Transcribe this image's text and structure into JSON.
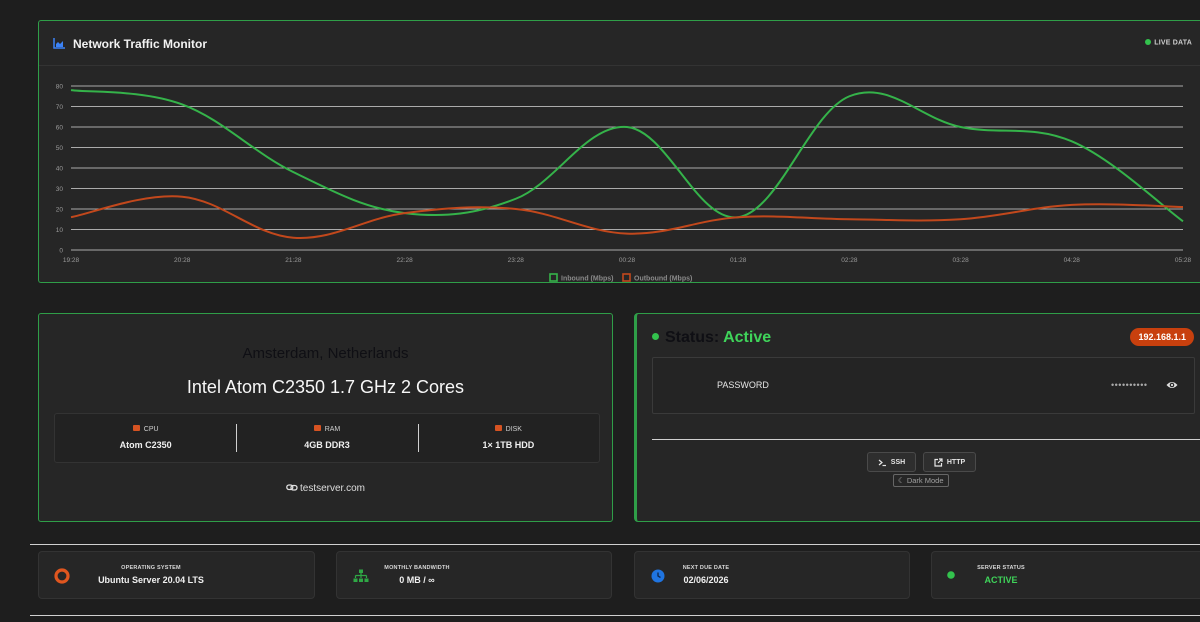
{
  "chart_panel": {
    "title": "Network Traffic Monitor",
    "live_label": "LIVE DATA",
    "chart_data": {
      "type": "line",
      "x": [
        "19:28",
        "20:28",
        "21:28",
        "22:28",
        "23:28",
        "00:28",
        "01:28",
        "02:28",
        "03:28",
        "04:28",
        "05:28"
      ],
      "ylim": [
        0,
        80
      ],
      "yticks": [
        0,
        10,
        20,
        30,
        40,
        50,
        60,
        70,
        80
      ],
      "grid": true,
      "legend_position": "bottom",
      "series": [
        {
          "name": "Inbound (Mbps)",
          "color": "#35b34a",
          "values": [
            78,
            71,
            38,
            18,
            25,
            60,
            16,
            75,
            60,
            53,
            14
          ]
        },
        {
          "name": "Outbound (Mbps)",
          "color": "#c2481c",
          "values": [
            16,
            26,
            6,
            18,
            20,
            8,
            16,
            15,
            15,
            22,
            21
          ]
        }
      ]
    }
  },
  "server": {
    "location": "Amsterdam, Netherlands",
    "cpu_title": "Intel Atom C2350 1.7 GHz 2 Cores",
    "specs": [
      {
        "label": "CPU",
        "value": "Atom C2350",
        "icon": "cpu-icon"
      },
      {
        "label": "RAM",
        "value": "4GB DDR3",
        "icon": "ram-icon"
      },
      {
        "label": "DISK",
        "value": "1× 1TB HDD",
        "icon": "disk-icon"
      }
    ],
    "website": "testserver.com"
  },
  "status": {
    "label": "Status:",
    "value": "Active",
    "ip": "192.168.1.1",
    "password_label": "PASSWORD",
    "password_mask": "••••••••••",
    "ssh_label": "SSH",
    "http_label": "HTTP",
    "dark_mode_label": "Dark Mode"
  },
  "cards": [
    {
      "label": "OPERATING SYSTEM",
      "value": "Ubuntu Server 20.04 LTS",
      "icon": "os-ring-icon",
      "color": "#e0561f"
    },
    {
      "label": "MONTHLY BANDWIDTH",
      "value": "0 MB / ∞",
      "icon": "network-icon",
      "color": "#2fa845"
    },
    {
      "label": "NEXT DUE DATE",
      "value": "02/06/2026",
      "icon": "clock-icon",
      "color": "#1f74e0"
    },
    {
      "label": "SERVER STATUS",
      "value": "ACTIVE",
      "icon": "status-dot-icon",
      "color": "#33c24d"
    }
  ],
  "colors": {
    "accent": "#2f9e48",
    "ip_badge": "#c8400e",
    "active": "#3fd45a"
  }
}
